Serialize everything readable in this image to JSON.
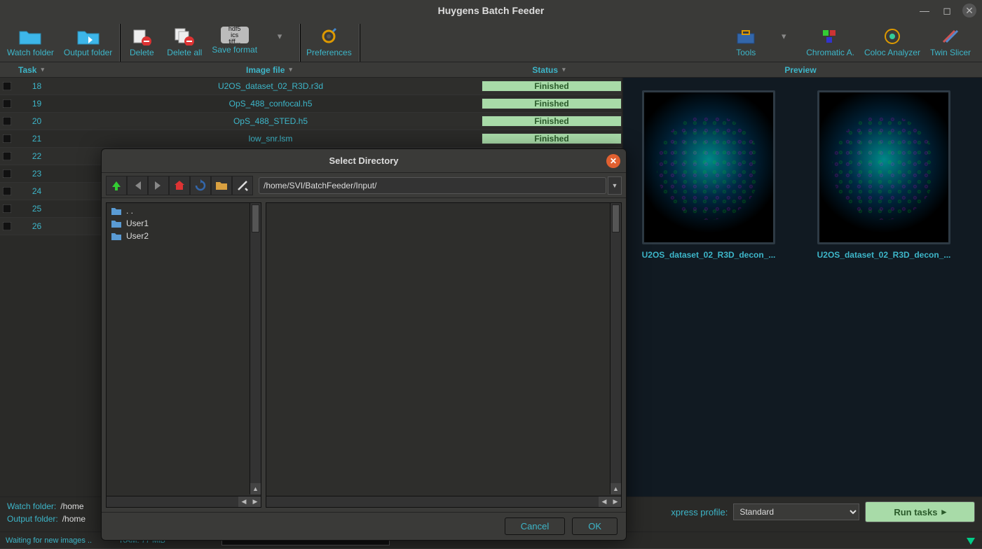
{
  "window": {
    "title": "Huygens Batch Feeder"
  },
  "toolbar": {
    "watch_folder": "Watch folder",
    "output_folder": "Output folder",
    "delete_": "Delete",
    "delete_all": "Delete all",
    "save_format": "Save format",
    "preferences": "Preferences",
    "tools": "Tools",
    "chromatic": "Chromatic A.",
    "coloc": "Coloc Analyzer",
    "twin": "Twin Slicer"
  },
  "headers": {
    "task": "Task",
    "file": "Image file",
    "status": "Status",
    "preview": "Preview"
  },
  "tasks": [
    {
      "num": "18",
      "file": "U2OS_dataset_02_R3D.r3d",
      "status": "Finished"
    },
    {
      "num": "19",
      "file": "OpS_488_confocal.h5",
      "status": "Finished"
    },
    {
      "num": "20",
      "file": "OpS_488_STED.h5",
      "status": "Finished"
    },
    {
      "num": "21",
      "file": "low_snr.lsm",
      "status": "Finished"
    },
    {
      "num": "22",
      "file": "",
      "status": ""
    },
    {
      "num": "23",
      "file": "",
      "status": ""
    },
    {
      "num": "24",
      "file": "",
      "status": ""
    },
    {
      "num": "25",
      "file": "",
      "status": ""
    },
    {
      "num": "26",
      "file": "",
      "status": ""
    }
  ],
  "preview": {
    "items": [
      {
        "caption": "U2OS_dataset_02_R3D_decon_..."
      },
      {
        "caption": "U2OS_dataset_02_R3D_decon_..."
      }
    ]
  },
  "bottom": {
    "watch_label": "Watch folder:",
    "watch_value": "/home",
    "output_label": "Output folder:",
    "output_value": "/home",
    "profile_label": "xpress profile:",
    "profile_value": "Standard",
    "run": "Run tasks"
  },
  "status": {
    "waiting": "Waiting for new images ..",
    "ram": "RAM: 77 MiB"
  },
  "dialog": {
    "title": "Select Directory",
    "path": "/home/SVI/BatchFeeder/Input/",
    "entries": [
      {
        "label": ". ."
      },
      {
        "label": "User1"
      },
      {
        "label": "User2"
      }
    ],
    "cancel": "Cancel",
    "ok": "OK"
  }
}
